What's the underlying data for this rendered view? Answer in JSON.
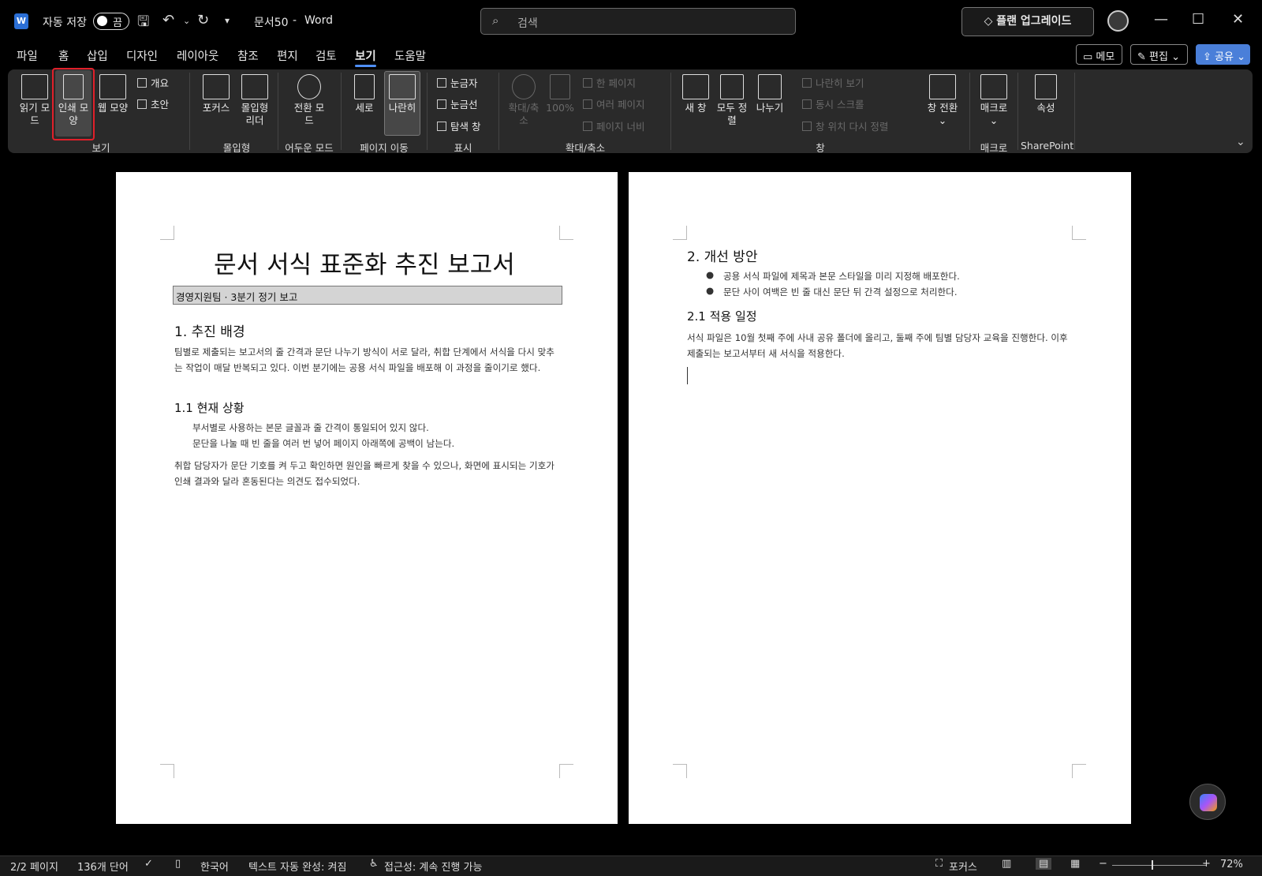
{
  "titlebar": {
    "autosave_label": "자동 저장",
    "autosave_state": "끔",
    "doc_name": "문서50",
    "separator": "-",
    "app_name": "Word",
    "search_placeholder": "검색",
    "upgrade_label": "플랜 업그레이드"
  },
  "menu": {
    "tabs": [
      "파일",
      "홈",
      "삽입",
      "디자인",
      "레이아웃",
      "참조",
      "편지",
      "검토",
      "보기",
      "도움말"
    ],
    "active_tab": "보기",
    "memo_label": "메모",
    "edit_label": "편집",
    "share_label": "공유"
  },
  "ribbon": {
    "view": {
      "read_mode": "읽기 모드",
      "print_layout": "인쇄 모양",
      "web_layout": "웹 모양",
      "outline": "개요",
      "draft": "초안",
      "group": "보기"
    },
    "immersive": {
      "focus": "포커스",
      "reader": "몰입형 리더",
      "group": "몰입형"
    },
    "dark": {
      "switch": "전환 모드",
      "group": "어두운 모드"
    },
    "page_move": {
      "vertical": "세로",
      "side": "나란히",
      "group": "페이지 이동"
    },
    "show": {
      "ruler": "눈금자",
      "gridlines": "눈금선",
      "nav_pane": "탐색 창",
      "group": "표시"
    },
    "zoom": {
      "zoom": "확대/축소",
      "pct": "100%",
      "one_page": "한 페이지",
      "multi_page": "여러 페이지",
      "page_width": "페이지 너비",
      "group": "확대/축소"
    },
    "window": {
      "new_window": "새 창",
      "arrange_all": "모두 정렬",
      "split": "나누기",
      "side_by_side": "나란히 보기",
      "sync_scroll": "동시 스크롤",
      "reset_pos": "창 위치 다시 정렬",
      "switch": "창 전환",
      "group": "창"
    },
    "macro": {
      "macros": "매크로",
      "group": "매크로"
    },
    "sharepoint": {
      "props": "속성",
      "group": "SharePoint"
    }
  },
  "document": {
    "title": "문서 서식 표준화 추진 보고서",
    "subtitle": "경영지원팀 · 3분기 정기 보고",
    "h1_background": "1. 추진 배경",
    "p1": "팀별로 제출되는 보고서의 줄 간격과 문단 나누기 방식이 서로 달라, 취합 단계에서 서식을 다시 맞추는 작업이 매달 반복되고 있다. 이번 분기에는 공용 서식 파일을 배포해 이 과정을 줄이기로 했다.",
    "h2_current": "1.1 현재 상황",
    "indent1": "부서별로 사용하는 본문 글꼴과 줄 간격이 통일되어 있지 않다.",
    "indent2": "문단을 나눌 때 빈 줄을 여러 번 넣어 페이지 아래쪽에 공백이 남는다.",
    "p2": "취합 담당자가 문단 기호를 켜 두고 확인하면 원인을 빠르게 찾을 수 있으나, 화면에 표시되는 기호가 인쇄 결과와 달라 혼동된다는 의견도 접수되었다.",
    "h1_improve": "2. 개선 방안",
    "bullet1": "공용 서식 파일에 제목과 본문 스타일을 미리 지정해 배포한다.",
    "bullet2": "문단 사이 여백은 빈 줄 대신 문단 뒤 간격 설정으로 처리한다.",
    "h2_schedule": "2.1 적용 일정",
    "p3": "서식 파일은 10월 첫째 주에 사내 공유 폴더에 올리고, 둘째 주에 팀별 담당자 교육을 진행한다. 이후 제출되는 보고서부터 새 서식을 적용한다."
  },
  "status": {
    "page": "2/2 페이지",
    "words": "136개 단어",
    "language": "한국어",
    "autocomplete": "텍스트 자동 완성: 켜짐",
    "accessibility": "접근성: 계속 진행 가능",
    "focus": "포커스",
    "zoom": "72%"
  }
}
